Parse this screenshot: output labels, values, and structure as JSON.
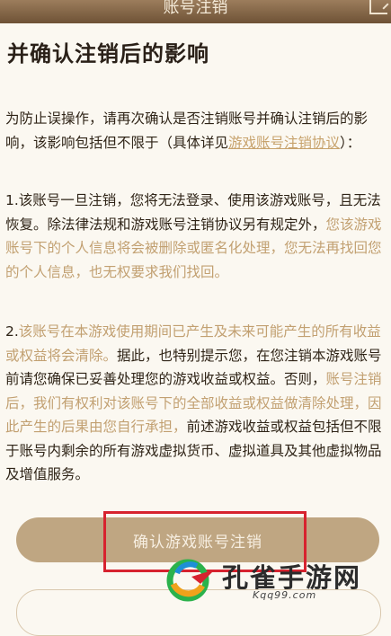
{
  "header": {
    "title": "账号注销",
    "corner_icon": "square-corner-icon"
  },
  "page": {
    "heading": "并确认注销后的影响",
    "intro": {
      "text_before": "为防止误操作，请再次确认是否注销账号并确认注销后的影响，该影响包括但不限于（具体详见",
      "link": "游戏账号注销协议",
      "text_after": "）："
    },
    "item1": {
      "text_normal": "1.该账号一旦注销，您将无法登录、使用该游戏账号，且无法恢复。除法律法规和游戏账号注销协议另有规定外，",
      "text_highlight": "您该游戏账号下的个人信息将会被删除或匿名化处理，您无法再找回您的个人信息，也无权要求我们找回。"
    },
    "item2": {
      "prefix": "2.",
      "highlight1": "该账号在本游戏使用期间已产生及未来可能产生的所有收益或权益将会清除。",
      "text1": "据此，也特别提示您，在您注销本游戏账号前请您确保已妥善处理您的游戏收益或权益。否则，",
      "highlight2": "账号注销后，我们有权利对该账号下的全部收益或权益做清除处理，因此产生的后果由您自行承担，",
      "text2": "前述游戏收益或权益包括但不限于账号内剩余的所有游戏虚拟货币、虚拟道具及其他虚拟物品及增值服务。"
    }
  },
  "actions": {
    "confirm_label": "确认游戏账号注销"
  },
  "watermark": {
    "text": "孔雀手游网",
    "url": "Kqq99.com"
  },
  "colors": {
    "accent": "#c2a071",
    "button": "#bfa682",
    "frame": "#d7232f",
    "title_bar": "#8a6b4a"
  }
}
